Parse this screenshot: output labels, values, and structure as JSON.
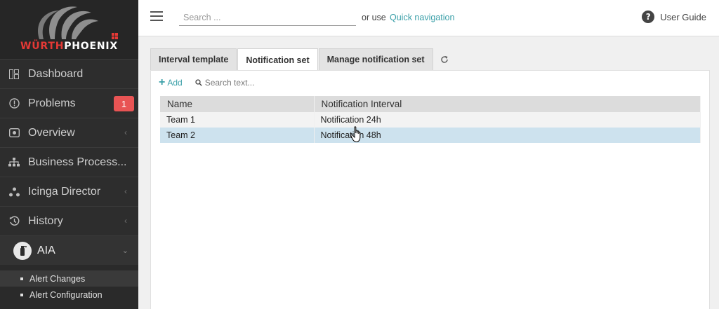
{
  "brand": {
    "logo_text_red": "WÜRTH",
    "logo_text_white": "PHOENIX",
    "accent_color": "#3a9fa8",
    "brand_red": "#e53935"
  },
  "sidebar": {
    "items": [
      {
        "label": "Dashboard",
        "icon": "dashboard-icon"
      },
      {
        "label": "Problems",
        "icon": "alert-circle-icon",
        "badge": "1"
      },
      {
        "label": "Overview",
        "icon": "eye-icon"
      },
      {
        "label": "Business Process...",
        "icon": "sitemap-icon"
      },
      {
        "label": "Icinga Director",
        "icon": "director-icon"
      },
      {
        "label": "History",
        "icon": "history-icon"
      }
    ],
    "active_module": {
      "label": "AIA",
      "icon": "aia-icon"
    },
    "sub_items": [
      {
        "label": "Alert Changes"
      },
      {
        "label": "Alert Configuration"
      }
    ]
  },
  "header": {
    "search_placeholder": "Search ...",
    "or_use": "or use",
    "quick_nav": "Quick navigation",
    "user_guide": "User Guide"
  },
  "tabs": [
    {
      "label": "Interval template",
      "active": false
    },
    {
      "label": "Notification set",
      "active": true
    },
    {
      "label": "Manage notification set",
      "active": false
    }
  ],
  "toolbar": {
    "add_label": "Add",
    "search_placeholder": "Search text..."
  },
  "table": {
    "columns": [
      "Name",
      "Notification Interval"
    ],
    "rows": [
      {
        "name": "Team 1",
        "interval": "Notification 24h",
        "selected": false
      },
      {
        "name": "Team 2",
        "interval": "Notification 48h",
        "selected": true
      }
    ]
  }
}
